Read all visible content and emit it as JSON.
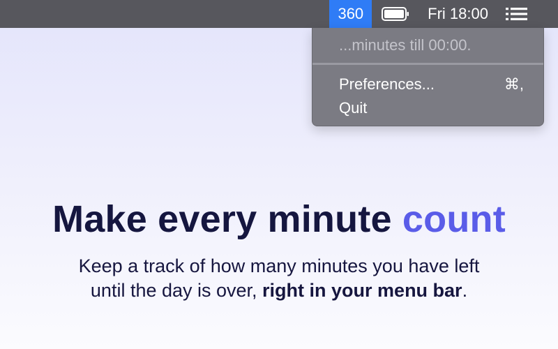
{
  "menubar": {
    "counter": "360",
    "battery_icon": "battery-icon",
    "clock": "Fri 18:00",
    "list_icon": "list-icon",
    "colors": {
      "bar": "#57575d",
      "counter_bg": "#2f7cf6"
    }
  },
  "dropdown": {
    "info": "...minutes till 00:00.",
    "items": [
      {
        "label": "Preferences...",
        "shortcut": "⌘,"
      },
      {
        "label": "Quit",
        "shortcut": ""
      }
    ]
  },
  "hero": {
    "headline_main": "Make every minute ",
    "headline_accent": "count",
    "subtitle_line1": "Keep a track of how many minutes you have left",
    "subtitle_line2_start": "until the day is over, ",
    "subtitle_line2_bold": "right in your menu bar",
    "subtitle_line2_end": ".",
    "accent_color": "#5a5ce8"
  }
}
